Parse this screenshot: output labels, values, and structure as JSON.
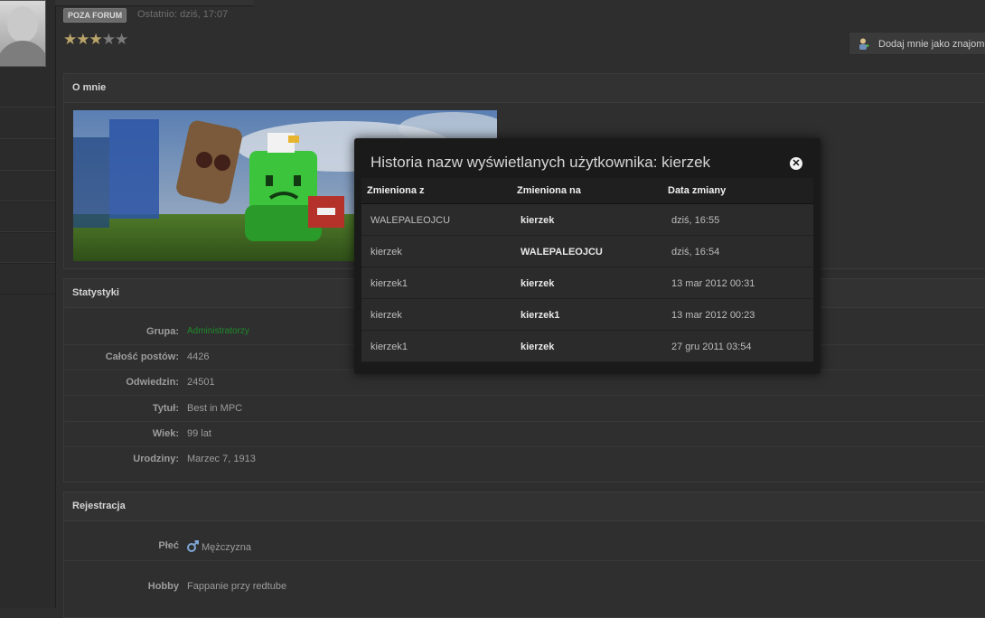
{
  "profile": {
    "badge": "POZA FORUM",
    "last_seen": "Ostatnio: dziś, 17:07",
    "rating": 3,
    "rating_max": 5,
    "add_friend_label": "Dodaj mnie jako znajome"
  },
  "about": {
    "title": "O mnie"
  },
  "stats": {
    "title": "Statystyki",
    "rows": [
      {
        "label": "Grupa:",
        "value": "Administratorzy"
      },
      {
        "label": "Całość postów:",
        "value": "4426"
      },
      {
        "label": "Odwiedzin:",
        "value": "24501"
      },
      {
        "label": "Tytuł:",
        "value": "Best in MPC"
      },
      {
        "label": "Wiek:",
        "value": "99 lat"
      },
      {
        "label": "Urodziny:",
        "value": "Marzec 7, 1913"
      }
    ]
  },
  "registration": {
    "title": "Rejestracja",
    "rows": [
      {
        "label": "Płeć",
        "value": "Mężczyzna"
      },
      {
        "label": "Hobby",
        "value": "Fappanie przy redtube"
      }
    ]
  },
  "modal": {
    "title": "Historia nazw wyświetlanych użytkownika: kierzek",
    "columns": [
      "Zmieniona z",
      "Zmieniona na",
      "Data zmiany"
    ],
    "rows": [
      {
        "from": "WALEPALEOJCU",
        "to": "kierzek",
        "date": "dziś, 16:55"
      },
      {
        "from": "kierzek",
        "to": "WALEPALEOJCU",
        "date": "dziś, 16:54"
      },
      {
        "from": "kierzek1",
        "to": "kierzek",
        "date": "13 mar 2012 00:31"
      },
      {
        "from": "kierzek",
        "to": "kierzek1",
        "date": "13 mar 2012 00:23"
      },
      {
        "from": "kierzek1",
        "to": "kierzek",
        "date": "27 gru 2011 03:54"
      }
    ]
  }
}
